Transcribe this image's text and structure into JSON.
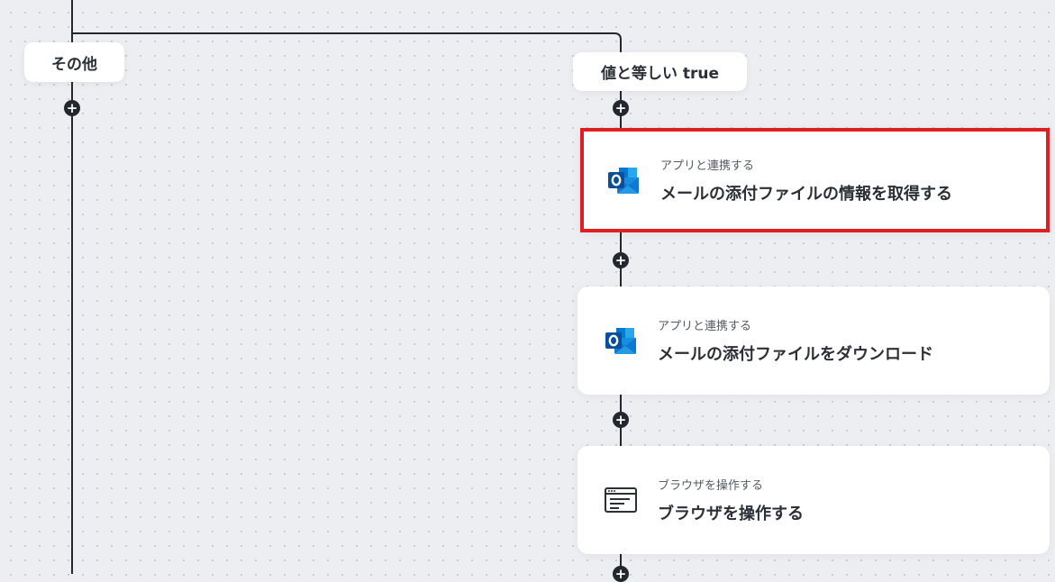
{
  "branches": {
    "else_label": "その他",
    "true_label": "値と等しい true"
  },
  "add_step_symbol": "+",
  "steps": [
    {
      "category": "アプリと連携する",
      "title": "メールの添付ファイルの情報を取得する",
      "icon": "outlook-icon",
      "selected": true
    },
    {
      "category": "アプリと連携する",
      "title": "メールの添付ファイルをダウンロード",
      "icon": "outlook-icon",
      "selected": false
    },
    {
      "category": "ブラウザを操作する",
      "title": "ブラウザを操作する",
      "icon": "browser-window-icon",
      "selected": false
    }
  ],
  "colors": {
    "canvas_bg": "#eceef2",
    "connector": "#23272e",
    "selection_border": "#e02020",
    "outlook_blue": "#0f78d4",
    "outlook_dark": "#0a4f9a"
  }
}
